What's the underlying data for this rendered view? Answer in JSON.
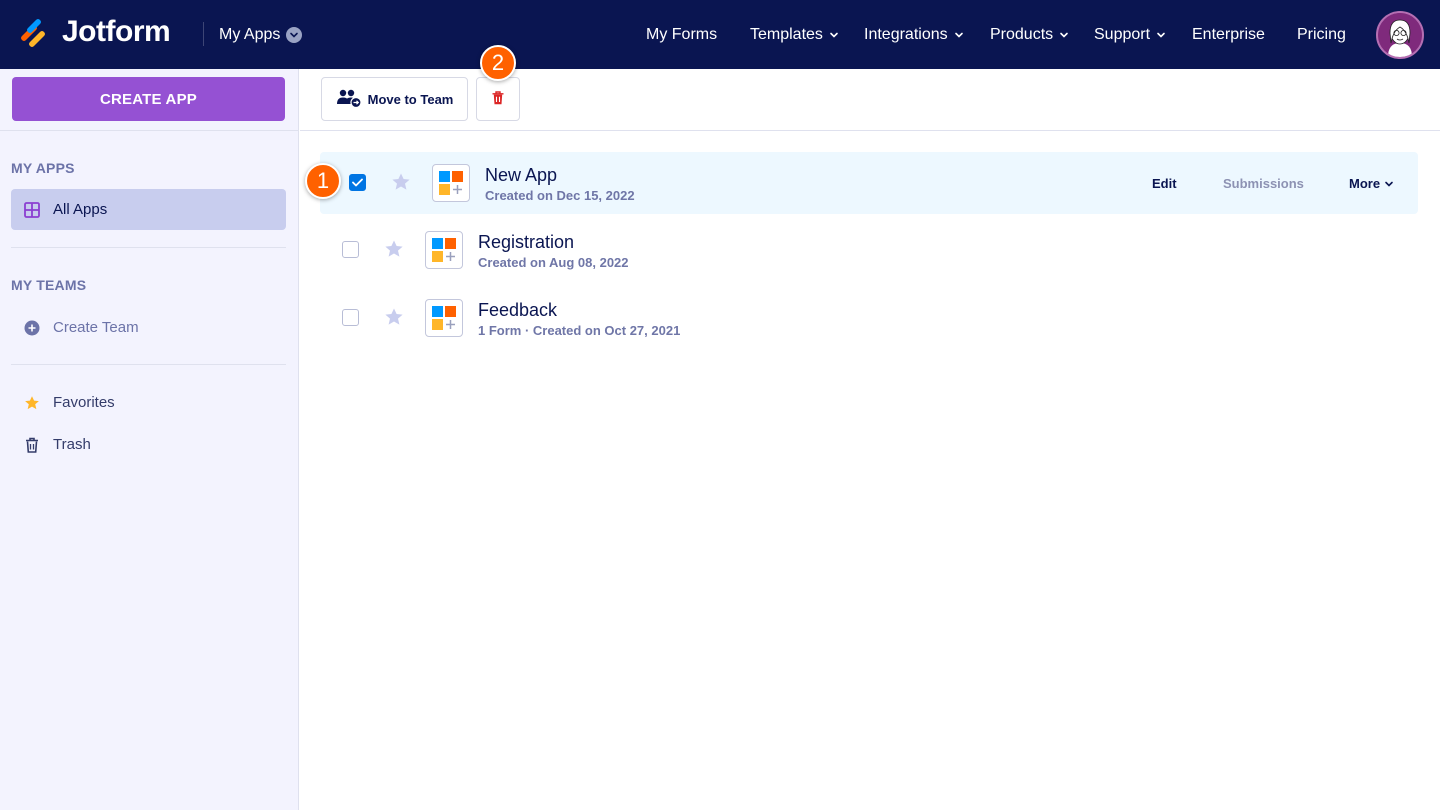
{
  "header": {
    "brand": "Jotform",
    "switcher_label": "My Apps",
    "nav": [
      {
        "label": "My Forms",
        "has_dropdown": false
      },
      {
        "label": "Templates",
        "has_dropdown": true
      },
      {
        "label": "Integrations",
        "has_dropdown": true
      },
      {
        "label": "Products",
        "has_dropdown": true
      },
      {
        "label": "Support",
        "has_dropdown": true
      },
      {
        "label": "Enterprise",
        "has_dropdown": false
      },
      {
        "label": "Pricing",
        "has_dropdown": false
      }
    ],
    "colors": {
      "background": "#0a1551",
      "text": "#ffffff"
    }
  },
  "sidebar": {
    "create_label": "CREATE APP",
    "my_apps_title": "MY APPS",
    "all_apps_label": "All Apps",
    "my_teams_title": "MY TEAMS",
    "create_team_label": "Create Team",
    "favorites_label": "Favorites",
    "trash_label": "Trash",
    "colors": {
      "create_button": "#9551d3",
      "active_item": "#c8cdee",
      "background": "#f3f3fe"
    }
  },
  "toolbar": {
    "move_to_team_label": "Move to Team",
    "delete_icon": "trash-icon",
    "colors": {
      "delete_icon": "#dc2626"
    }
  },
  "steps": {
    "one": "1",
    "two": "2",
    "color": "#ff6100"
  },
  "apps": [
    {
      "title": "New App",
      "subtitle": "Created on Dec 15, 2022",
      "checked": true,
      "selected": true
    },
    {
      "title": "Registration",
      "subtitle": "Created on Aug 08, 2022",
      "checked": false,
      "selected": false
    },
    {
      "title": "Feedback",
      "subtitle": "1 Form · Created on Oct 27, 2021",
      "checked": false,
      "selected": false
    }
  ],
  "row_actions": {
    "edit_label": "Edit",
    "submissions_label": "Submissions",
    "more_label": "More"
  }
}
